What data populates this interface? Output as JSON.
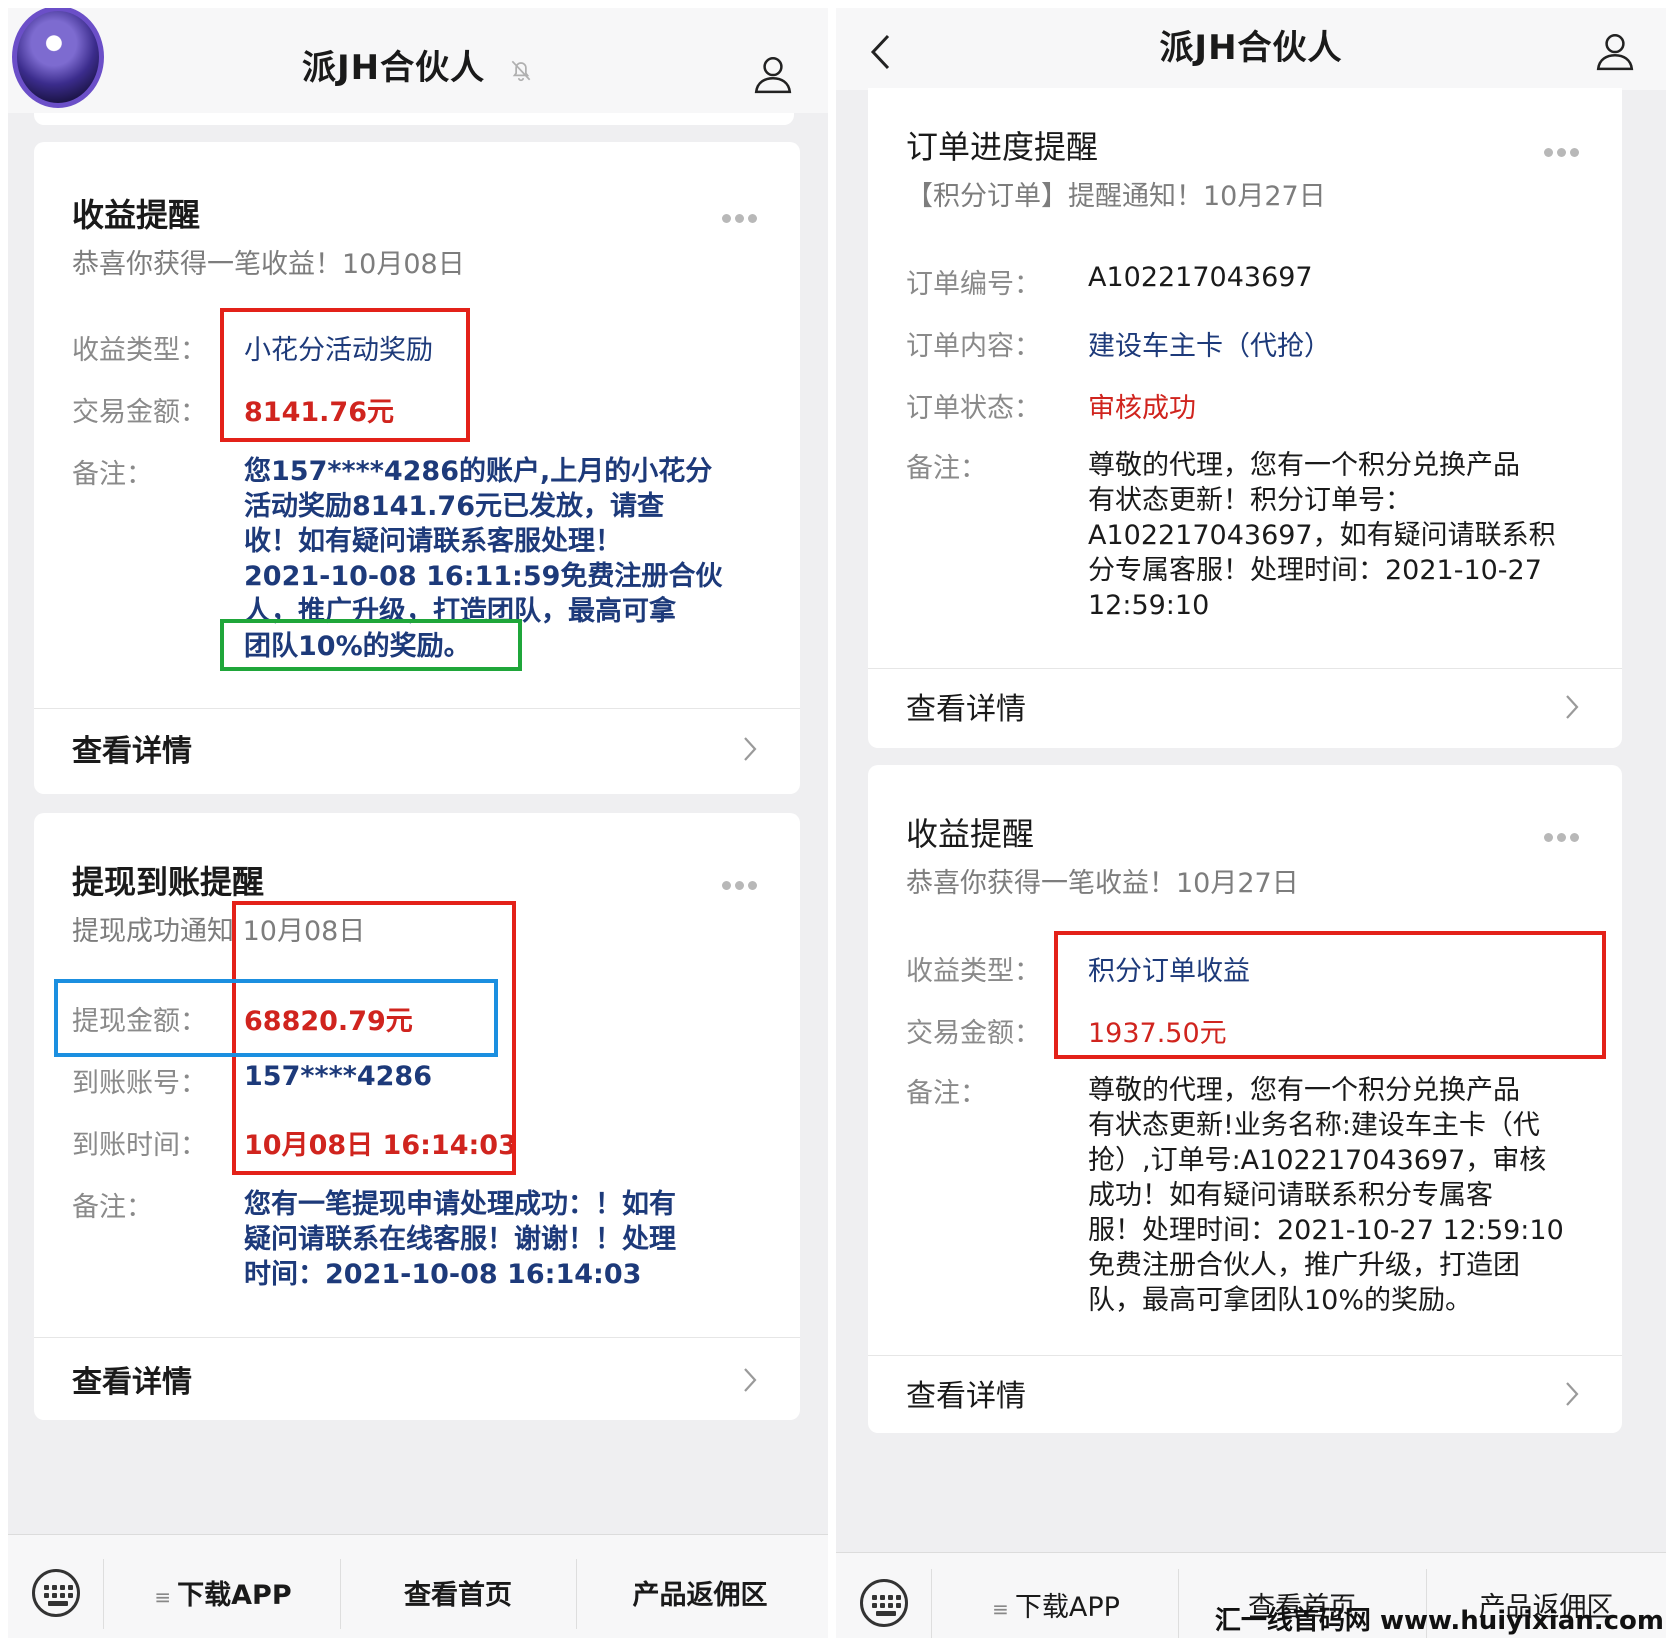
{
  "left": {
    "title": "派JH合伙人",
    "card1": {
      "header": "收益提醒",
      "subtitle": "恭喜你获得一笔收益！10月08日",
      "type_label": "收益类型：",
      "type_value": "小花分活动奖励",
      "amount_label": "交易金额：",
      "amount_value": "8141.76元",
      "note_label": "备注：",
      "note_lines": [
        "您157****4286的账户,上月的小花分",
        "活动奖励8141.76元已发放，请查",
        "收！如有疑问请联系客服处理！",
        "2021-10-08 16:11:59免费注册合伙",
        "人，推广升级，打造团队，最高可拿",
        "团队10%的奖励。"
      ],
      "detail": "查看详情"
    },
    "card2": {
      "header": "提现到账提醒",
      "subtitle": "提现成功通知 10月08日",
      "amount_label": "提现金额：",
      "amount_value": "68820.79元",
      "account_label": "到账账号：",
      "account_value": "157****4286",
      "time_label": "到账时间：",
      "time_value": "10月08日 16:14:03",
      "note_label": "备注：",
      "note_lines": [
        "您有一笔提现申请处理成功：！如有",
        "疑问请联系在线客服！谢谢！！处理",
        "时间：2021-10-08 16:14:03"
      ],
      "detail": "查看详情"
    },
    "menu": [
      "下载APP",
      "查看首页",
      "产品返佣区"
    ]
  },
  "right": {
    "title": "派JH合伙人",
    "card1": {
      "header": "订单进度提醒",
      "subtitle": "【积分订单】提醒通知！10月27日",
      "order_no_label": "订单编号：",
      "order_no_value": "A102217043697",
      "content_label": "订单内容：",
      "content_value": "建设车主卡（代抢）",
      "status_label": "订单状态：",
      "status_value": "审核成功",
      "note_label": "备注：",
      "note_lines": [
        "尊敬的代理，您有一个积分兑换产品",
        "有状态更新！积分订单号：",
        "A102217043697，如有疑问请联系积",
        "分专属客服！处理时间：2021-10-27",
        "12:59:10"
      ],
      "detail": "查看详情"
    },
    "card2": {
      "header": "收益提醒",
      "subtitle": "恭喜你获得一笔收益！10月27日",
      "type_label": "收益类型：",
      "type_value": "积分订单收益",
      "amount_label": "交易金额：",
      "amount_value": "1937.50元",
      "note_label": "备注：",
      "note_lines": [
        "尊敬的代理，您有一个积分兑换产品",
        "有状态更新!业务名称:建设车主卡（代",
        "抢）,订单号:A102217043697，审核",
        "成功！如有疑问请联系积分专属客",
        "服！处理时间：2021-10-27 12:59:10",
        "免费注册合伙人，推广升级，打造团",
        "队，最高可拿团队10%的奖励。"
      ],
      "detail": "查看详情"
    },
    "menu": [
      "下载APP",
      "查看首页",
      "产品返佣区"
    ],
    "watermark": "汇一线首码网 www.huiyixian.com"
  }
}
